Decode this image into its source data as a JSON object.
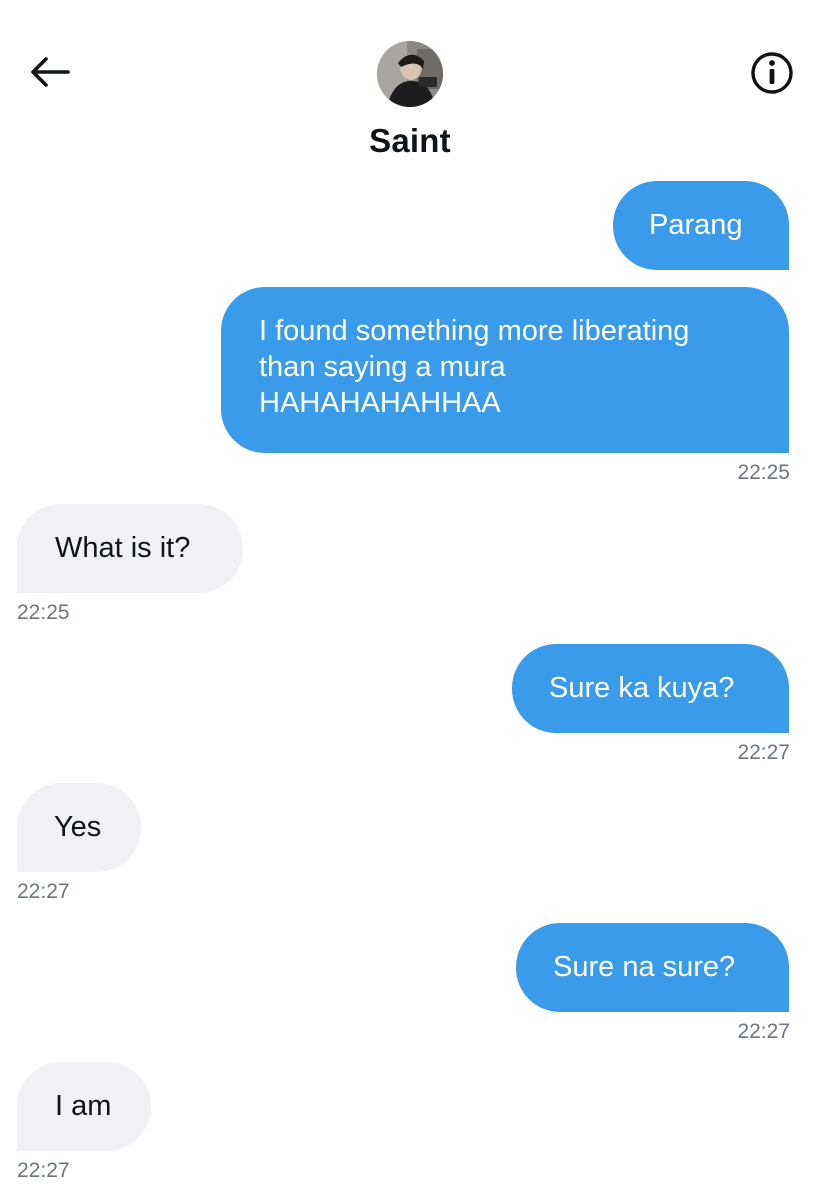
{
  "header": {
    "contact_name": "Saint"
  },
  "messages": [
    {
      "direction": "outgoing",
      "text": "Parang",
      "time": ""
    },
    {
      "direction": "outgoing",
      "text": "I found something more liberating\nthan saying a mura\nHAHAHAHAHHAA",
      "time": "22:25"
    },
    {
      "direction": "incoming",
      "text": "What is it?",
      "time": "22:25"
    },
    {
      "direction": "outgoing",
      "text": "Sure ka kuya?",
      "time": "22:27"
    },
    {
      "direction": "incoming",
      "text": "Yes",
      "time": "22:27"
    },
    {
      "direction": "outgoing",
      "text": "Sure na sure?",
      "time": "22:27"
    },
    {
      "direction": "incoming",
      "text": "I am",
      "time": "22:27"
    }
  ],
  "colors": {
    "outgoing_bubble": "#3a9bea",
    "incoming_bubble": "#eff1f4",
    "timestamp": "#6d7680"
  },
  "icons": {
    "back": "arrow-left-icon",
    "info": "info-icon"
  }
}
